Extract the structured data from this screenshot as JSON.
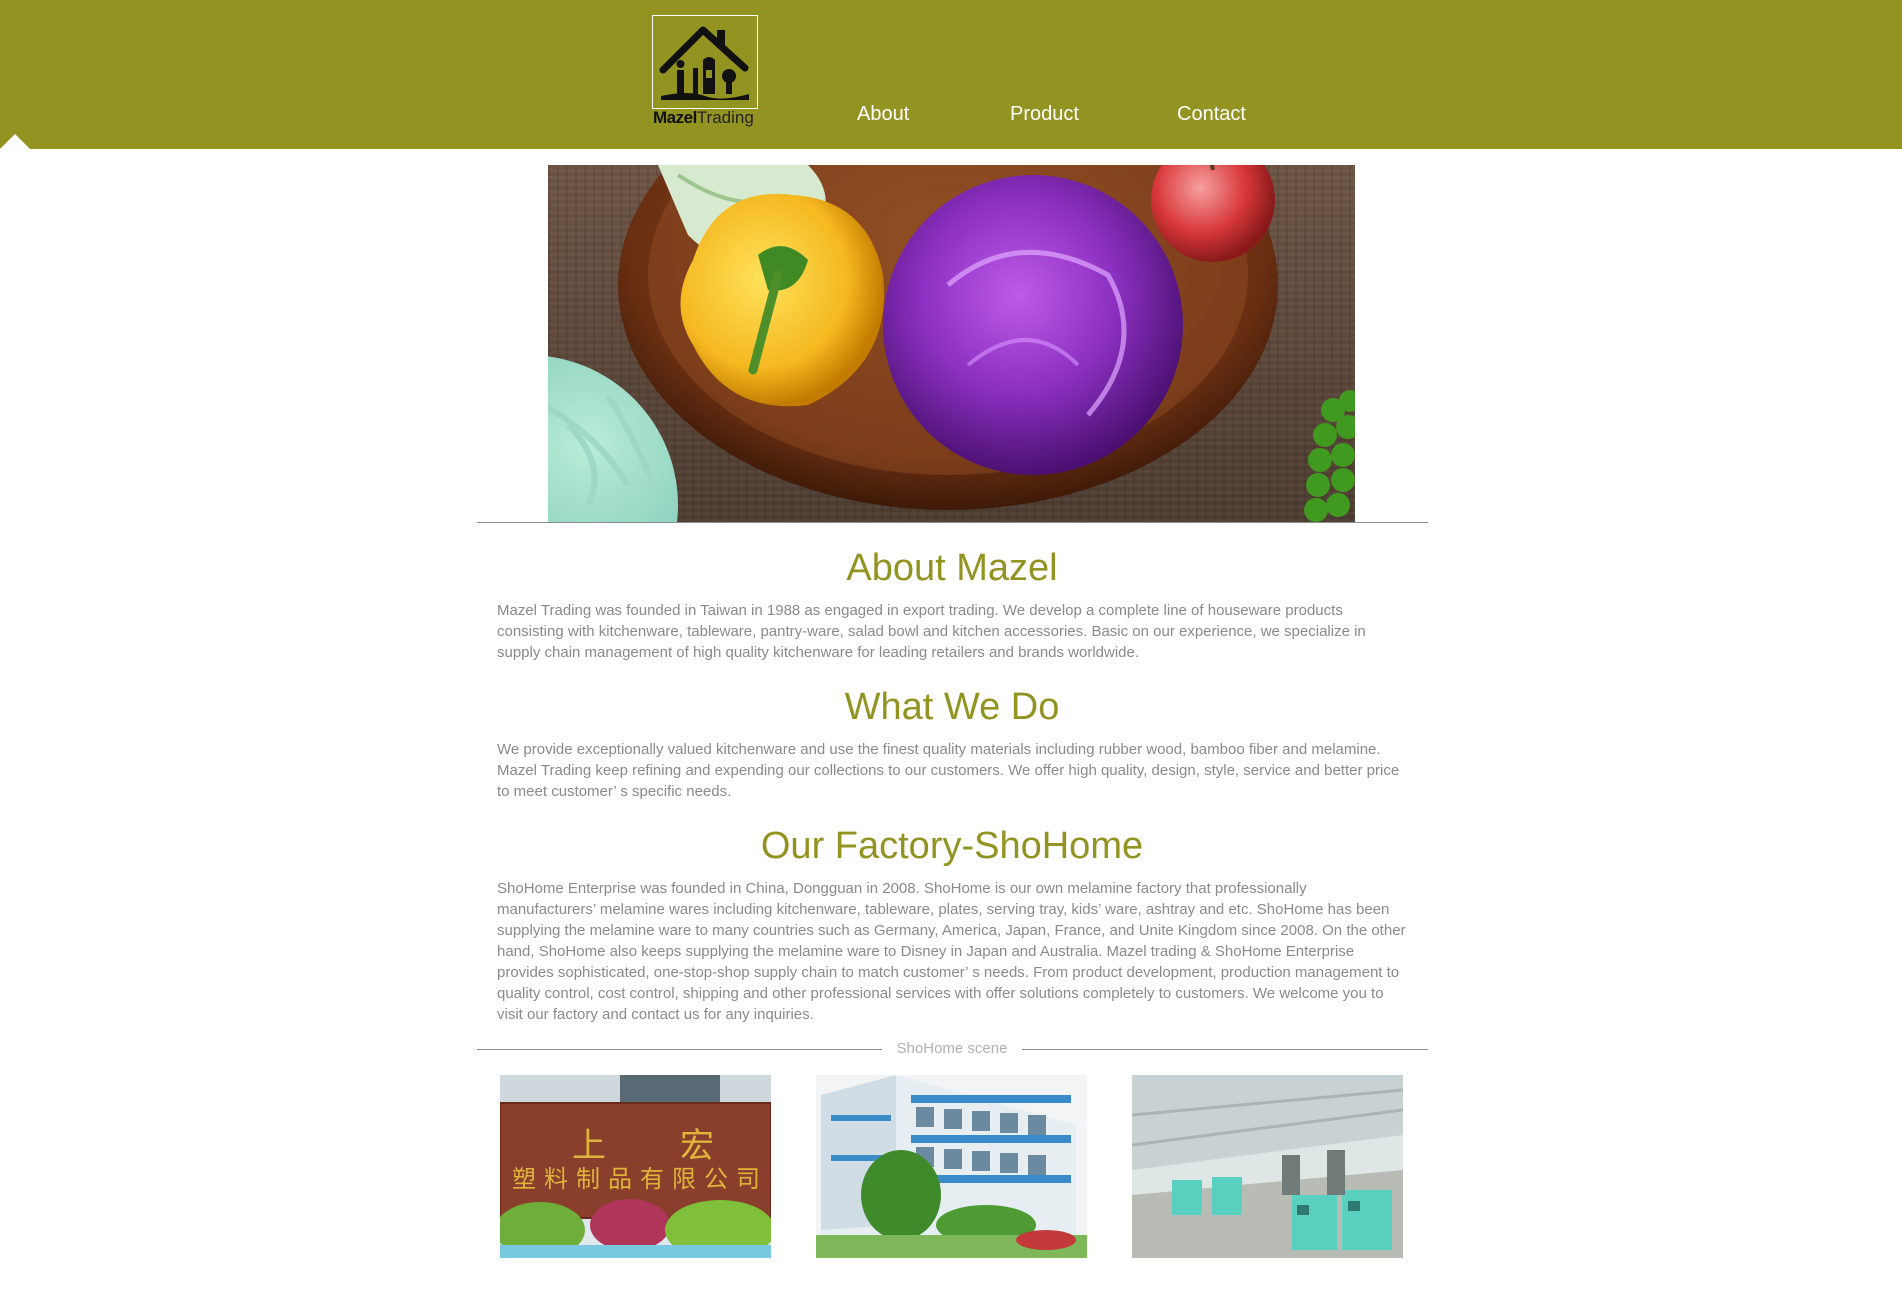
{
  "brand": {
    "name_bold": "Mazel",
    "name_regular": "Trading",
    "color": "#939322"
  },
  "nav": {
    "items": [
      {
        "label": "About"
      },
      {
        "label": "Product"
      },
      {
        "label": "Contact"
      }
    ]
  },
  "sections": [
    {
      "heading": "About Mazel",
      "body": "Mazel Trading was founded in Taiwan in 1988 as engaged in export trading. We develop a complete line of houseware products consisting with kitchenware, tableware, pantry-ware, salad bowl and kitchen accessories. Basic on our experience, we specialize in supply chain management of high quality kitchenware for leading retailers and brands worldwide."
    },
    {
      "heading": "What We Do",
      "body": "We provide exceptionally valued kitchenware and use the finest quality materials including rubber wood, bamboo fiber and melamine. Mazel Trading keep refining and expending our collections to our customers. We offer high quality, design, style, service and better price to meet customer’ s specific needs."
    },
    {
      "heading": "Our Factory-ShoHome",
      "body": "ShoHome Enterprise was founded in China, Dongguan in 2008. ShoHome is our own melamine factory that professionally manufacturers’ melamine wares including kitchenware, tableware, plates, serving tray, kids’ ware, ashtray and etc. ShoHome has been supplying the melamine ware to many countries such as Germany, America, Japan, France, and Unite Kingdom since 2008. On the other hand, ShoHome also keeps supplying the melamine ware to Disney in Japan and Australia. Mazel trading & ShoHome Enterprise provides sophisticated, one-stop-shop supply chain to match customer’ s needs. From product development, production management to quality control, cost control, shipping and other professional services with offer solutions completely to customers. We welcome you to visit our factory and contact us for any inquiries."
    }
  ],
  "scene": {
    "label": "ShoHome scene",
    "sign_line1_a": "上",
    "sign_line1_b": "宏",
    "sign_line2": "塑料制品有限公司"
  },
  "icons": {
    "logo": "house-logo-icon"
  }
}
